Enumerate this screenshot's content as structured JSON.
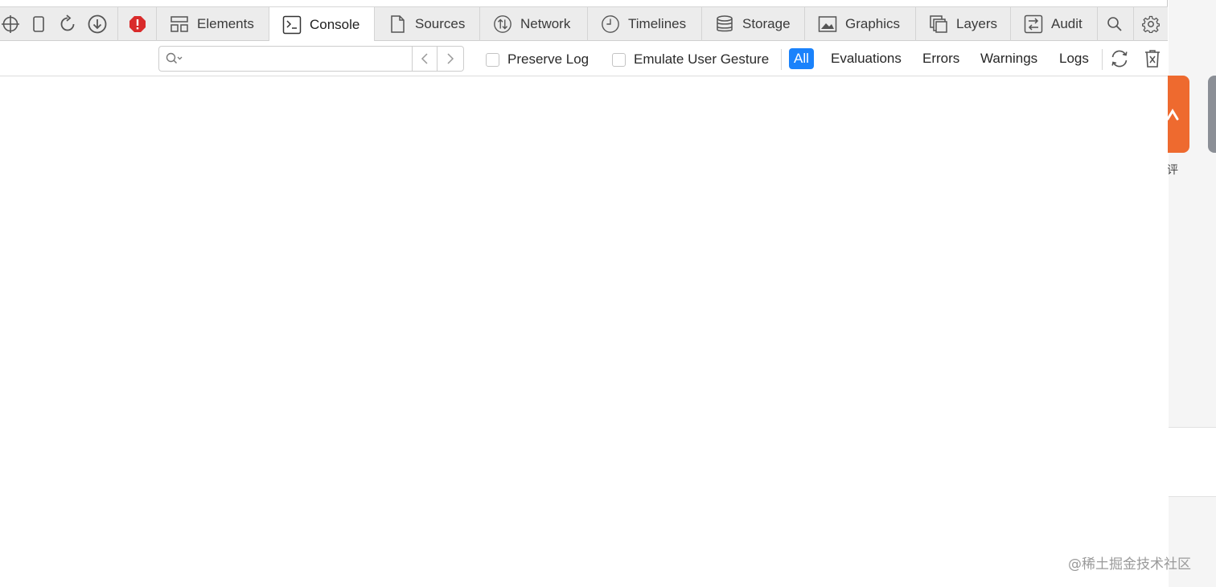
{
  "toolbar": {
    "icons": [
      "crosshair-icon",
      "device-icon",
      "reload-icon",
      "download-icon",
      "error-badge-icon"
    ],
    "error_color": "#d92b2b"
  },
  "tabs": [
    {
      "label": "Elements",
      "icon": "elements-icon",
      "active": false
    },
    {
      "label": "Console",
      "icon": "console-icon",
      "active": true
    },
    {
      "label": "Sources",
      "icon": "sources-icon",
      "active": false
    },
    {
      "label": "Network",
      "icon": "network-icon",
      "active": false
    },
    {
      "label": "Timelines",
      "icon": "timelines-icon",
      "active": false
    },
    {
      "label": "Storage",
      "icon": "storage-icon",
      "active": false
    },
    {
      "label": "Graphics",
      "icon": "graphics-icon",
      "active": false
    },
    {
      "label": "Layers",
      "icon": "layers-icon",
      "active": false
    },
    {
      "label": "Audit",
      "icon": "audit-icon",
      "active": false
    }
  ],
  "filter": {
    "search_value": "",
    "search_placeholder": "",
    "preserve_log_label": "Preserve Log",
    "preserve_log_checked": false,
    "emulate_gesture_label": "Emulate User Gesture",
    "emulate_gesture_checked": false,
    "types": [
      {
        "label": "All",
        "selected": true
      },
      {
        "label": "Evaluations",
        "selected": false
      },
      {
        "label": "Errors",
        "selected": false
      },
      {
        "label": "Warnings",
        "selected": false
      },
      {
        "label": "Logs",
        "selected": false
      }
    ],
    "accent_color": "#1a82fb"
  },
  "page_behind": {
    "partial_char": "评",
    "watermark": "@稀土掘金技术社区",
    "orange_color": "#ee6a2f"
  }
}
